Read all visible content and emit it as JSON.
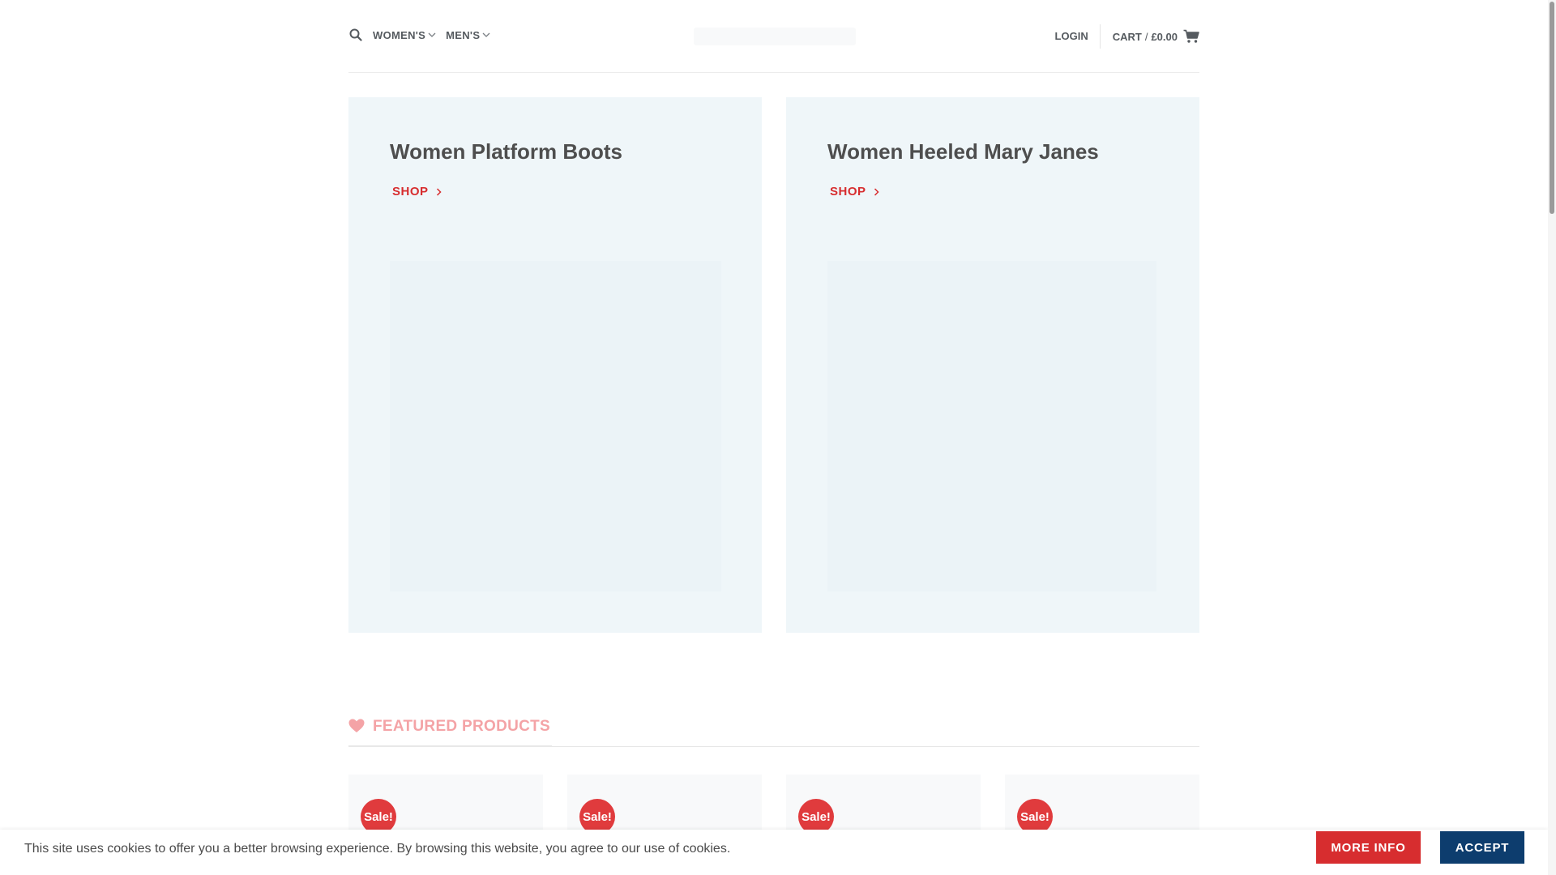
{
  "header": {
    "nav": [
      {
        "label": "WOMEN'S"
      },
      {
        "label": "MEN'S"
      }
    ],
    "login_label": "LOGIN",
    "cart_label": "CART",
    "cart_sep": "/",
    "cart_total": "£0.00"
  },
  "hero": [
    {
      "title": "Women Platform Boots",
      "link": "SHOP"
    },
    {
      "title": "Women Heeled Mary Janes",
      "link": "SHOP"
    }
  ],
  "featured": {
    "title": "FEATURED PRODUCTS",
    "icon": "heart-icon",
    "color": "#f4a3a6"
  },
  "products": [
    {
      "badge": "Sale!"
    },
    {
      "badge": "Sale!"
    },
    {
      "badge": "Sale!"
    },
    {
      "badge": "Sale!"
    }
  ],
  "cookie": {
    "text": "This site uses cookies to offer you a better browsing experience. By browsing this website, you agree to our use of cookies.",
    "more_label": "MORE INFO",
    "accept_label": "ACCEPT"
  },
  "colors": {
    "accent": "#d72d2f",
    "accept": "#0d3d6e",
    "card_bg": "#eff6f9",
    "text": "#555a5f"
  }
}
